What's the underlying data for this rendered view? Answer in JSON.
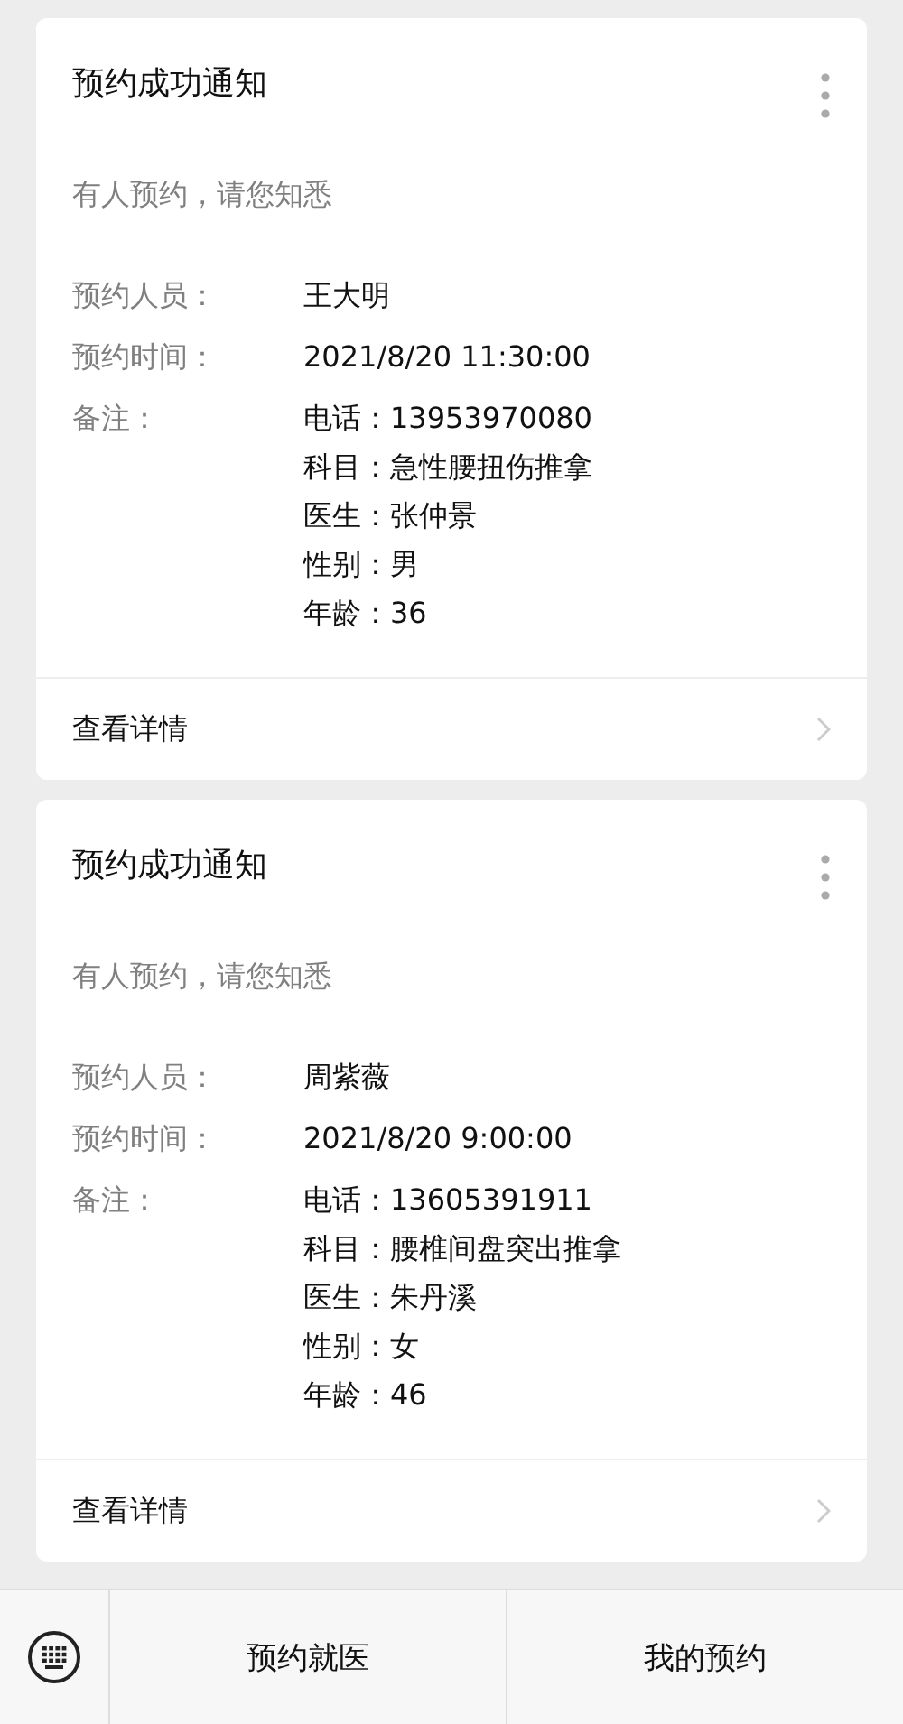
{
  "cards": [
    {
      "title": "预约成功通知",
      "subtitle": "有人预约，请您知悉",
      "fields": [
        {
          "label": "预约人员：",
          "values": [
            "王大明"
          ]
        },
        {
          "label": "预约时间：",
          "values": [
            "2021/8/20 11:30:00"
          ]
        },
        {
          "label": "备注：",
          "values": [
            "电话：13953970080",
            "科目：急性腰扭伤推拿",
            "医生：张仲景",
            "性别：男",
            "年龄：36"
          ]
        }
      ],
      "link": "查看详情"
    },
    {
      "title": "预约成功通知",
      "subtitle": "有人预约，请您知悉",
      "fields": [
        {
          "label": "预约人员：",
          "values": [
            "周紫薇"
          ]
        },
        {
          "label": "预约时间：",
          "values": [
            "2021/8/20 9:00:00"
          ]
        },
        {
          "label": "备注：",
          "values": [
            "电话：13605391911",
            "科目：腰椎间盘突出推拿",
            "医生：朱丹溪",
            "性别：女",
            "年龄：46"
          ]
        }
      ],
      "link": "查看详情"
    }
  ],
  "bottom_bar": {
    "items": [
      "预约就医",
      "我的预约"
    ]
  }
}
